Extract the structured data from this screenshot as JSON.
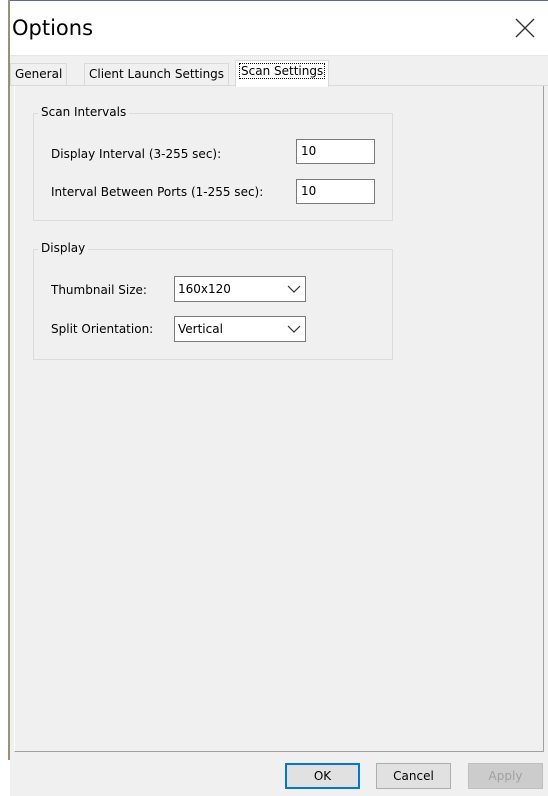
{
  "window": {
    "title": "Options"
  },
  "tabs": [
    {
      "label": "General",
      "active": false
    },
    {
      "label": "Client Launch Settings",
      "active": false
    },
    {
      "label": "Scan Settings",
      "active": true
    }
  ],
  "scan_intervals": {
    "legend": "Scan Intervals",
    "display_interval_label": "Display Interval (3-255 sec):",
    "display_interval_value": "10",
    "ports_interval_label": "Interval Between Ports (1-255 sec):",
    "ports_interval_value": "10"
  },
  "display": {
    "legend": "Display",
    "thumbnail_label": "Thumbnail Size:",
    "thumbnail_value": "160x120",
    "split_label": "Split Orientation:",
    "split_value": "Vertical"
  },
  "buttons": {
    "ok": "OK",
    "cancel": "Cancel",
    "apply": "Apply"
  },
  "icons": {
    "close": "close-icon",
    "dropdown": "chevron-down-icon"
  },
  "colors": {
    "default_button_border": "#0078d7",
    "dialog_background": "#f0f0f0"
  }
}
